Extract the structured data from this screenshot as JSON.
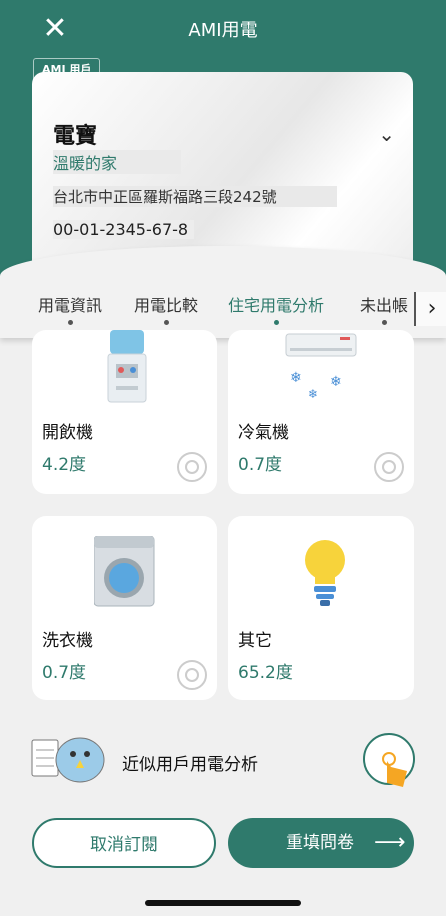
{
  "header": {
    "title": "AMI用電",
    "close_icon": "close-icon"
  },
  "account": {
    "badge": "AMI 用戶",
    "name": "電寶",
    "nickname": "溫暖的家",
    "address": "台北市中正區羅斯福路三段242號",
    "number": "00-01-2345-67-8"
  },
  "tabs": [
    {
      "label": "用電資訊",
      "active": false
    },
    {
      "label": "用電比較",
      "active": false
    },
    {
      "label": "住宅用電分析",
      "active": true
    },
    {
      "label": "未出帳",
      "active": false
    }
  ],
  "appliances": [
    {
      "label": "開飲機",
      "value": "4.2度",
      "icon": "water-dispenser-icon"
    },
    {
      "label": "冷氣機",
      "value": "0.7度",
      "icon": "air-conditioner-icon"
    },
    {
      "label": "洗衣機",
      "value": "0.7度",
      "icon": "washing-machine-icon"
    },
    {
      "label": "其它",
      "value": "65.2度",
      "icon": "light-bulb-icon"
    }
  ],
  "promo": {
    "text": "近似用戶用電分析"
  },
  "buttons": {
    "cancel": "取消訂閱",
    "refill": "重填問卷"
  },
  "colors": {
    "primary": "#2f7a6c"
  }
}
